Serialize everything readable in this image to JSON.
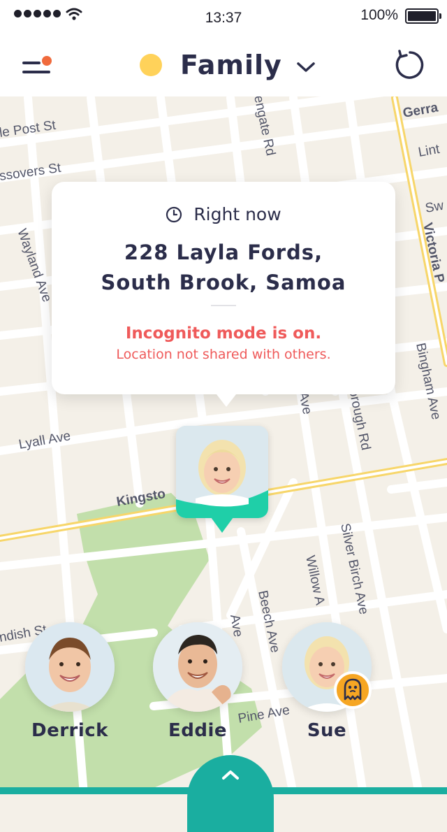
{
  "status_bar": {
    "time": "13:37",
    "battery": "100%"
  },
  "header": {
    "group_name": "Family",
    "menu_icon": "menu-icon",
    "refresh_icon": "refresh-icon",
    "group_color": "#ffd25a"
  },
  "map": {
    "streets": [
      "le Post St",
      "ssovers St",
      "Wayland Ave",
      "engate Rd",
      "Gerra",
      "Lint",
      "Sw",
      "Victoria P",
      "Bingham Ave",
      "orough Rd",
      "Ave",
      "Lyall Ave",
      "Kingsto",
      "Silver Birch Ave",
      "Willow A",
      "Beech Ave",
      "Ave",
      "Pine Ave",
      "ndish St"
    ]
  },
  "info_card": {
    "time_label": "Right now",
    "address_line1": "228 Layla Fords,",
    "address_line2": "South Brook, Samoa",
    "warning_title": "Incognito mode is on.",
    "warning_subtitle": "Location not shared with others."
  },
  "members": [
    {
      "name": "Derrick"
    },
    {
      "name": "Eddie"
    },
    {
      "name": "Sue",
      "badge": "ghost-icon"
    }
  ],
  "colors": {
    "accent": "#1aaea0",
    "warning": "#ef5a5a",
    "pin": "#1fcfa8",
    "badge": "#f6a623"
  }
}
